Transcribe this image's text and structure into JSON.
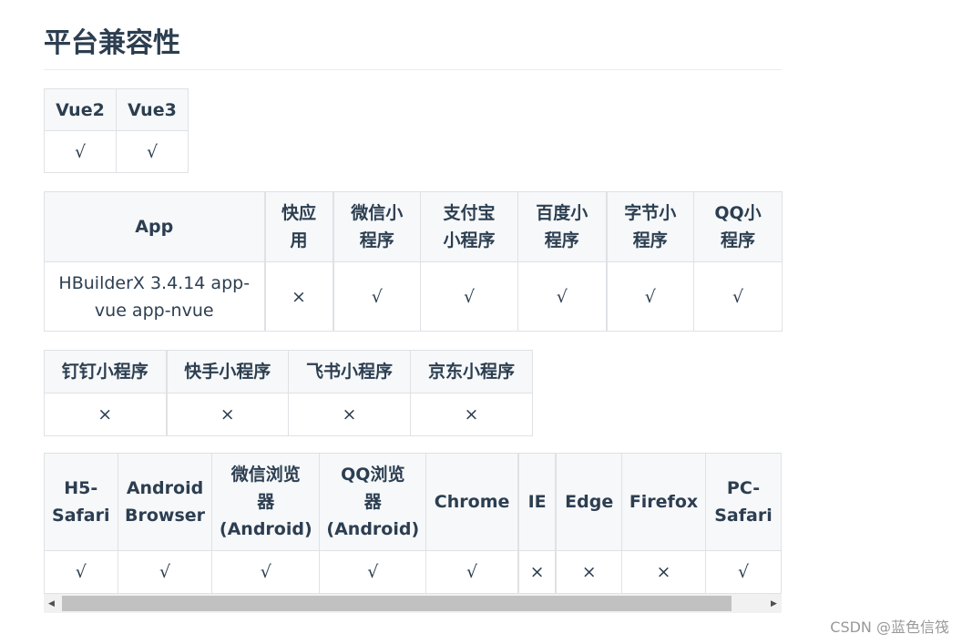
{
  "page": {
    "title": "平台兼容性"
  },
  "vue_table": {
    "headers": [
      "Vue2",
      "Vue3"
    ],
    "row": [
      "√",
      "√"
    ]
  },
  "app_table": {
    "headers": [
      "App",
      "快应用",
      "微信小程序",
      "支付宝小程序",
      "百度小程序",
      "字节小程序",
      "QQ小程序"
    ],
    "header_lines": [
      [
        "App"
      ],
      [
        "快应",
        "用"
      ],
      [
        "微信小",
        "程序"
      ],
      [
        "支付宝",
        "小程序"
      ],
      [
        "百度小",
        "程序"
      ],
      [
        "字节小",
        "程序"
      ],
      [
        "QQ小",
        "程序"
      ]
    ],
    "row": [
      "HBuilderX 3.4.14 app-vue app-nvue",
      "×",
      "√",
      "√",
      "√",
      "√",
      "√"
    ],
    "app_cell_lines": [
      "HBuilderX 3.4.14 app-",
      "vue app-nvue"
    ]
  },
  "miniprogram_table": {
    "headers": [
      "钉钉小程序",
      "快手小程序",
      "飞书小程序",
      "京东小程序"
    ],
    "row": [
      "×",
      "×",
      "×",
      "×"
    ]
  },
  "browser_table": {
    "headers": [
      "H5-Safari",
      "Android Browser",
      "微信浏览器(Android)",
      "QQ浏览器(Android)",
      "Chrome",
      "IE",
      "Edge",
      "Firefox",
      "PC-Safari"
    ],
    "header_lines": [
      [
        "H5-",
        "Safari"
      ],
      [
        "Android",
        "Browser"
      ],
      [
        "微信浏览",
        "器",
        "(Android)"
      ],
      [
        "QQ浏览",
        "器",
        "(Android)"
      ],
      [
        "Chrome"
      ],
      [
        "IE"
      ],
      [
        "Edge"
      ],
      [
        "Firefox"
      ],
      [
        "PC-",
        "Safari"
      ]
    ],
    "row": [
      "√",
      "√",
      "√",
      "√",
      "√",
      "×",
      "×",
      "×",
      "√"
    ]
  },
  "scrollbar": {
    "left_arrow": "◀",
    "right_arrow": "▶"
  },
  "watermark": "CSDN @蓝色信筏"
}
